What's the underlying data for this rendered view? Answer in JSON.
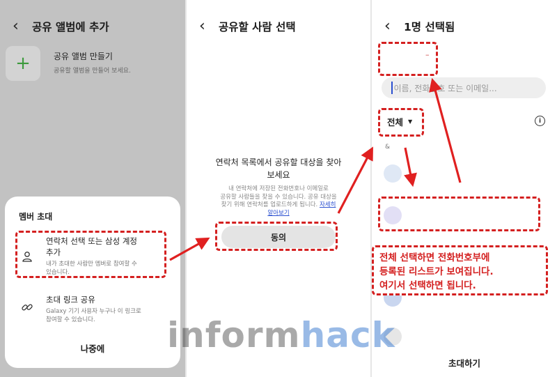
{
  "panel1": {
    "title": "공유 앨범에 추가",
    "create_album": {
      "title": "공유 앨범 만들기",
      "subtitle": "공유할 앨범을 만들어 보세요."
    },
    "invite_sheet": {
      "title": "멤버 초대",
      "option1": {
        "title_line1": "연락처 선택 또는 삼성 계정",
        "title_line2": "추가",
        "sub_line1": "내가 초대한 사람만 멤버로 참여할 수",
        "sub_line2": "있습니다."
      },
      "option2": {
        "title": "초대 링크 공유",
        "sub_line1": "Galaxy 기기 사용자 누구나 이 링크로",
        "sub_line2": "참여할 수 있습니다."
      },
      "later_label": "나중에"
    }
  },
  "panel2": {
    "title": "공유할 사람 선택",
    "prompt_line1": "연락처 목록에서 공유할 대상을 찾아",
    "prompt_line2": "보세요",
    "desc_line1": "내 연락처에 저장된 전화번호나 이메일로",
    "desc_line2": "공유할 사람들을 찾을 수 있습니다. 공유 대상을",
    "desc_line3": "찾기 위해 연락처를 업로드하게 됩니다.",
    "desc_link": "자세히",
    "learn_more": "알아보기",
    "agree_label": "동의"
  },
  "panel3": {
    "title": "1명 선택됨",
    "chip_remove": "–",
    "search_placeholder": "이름, 전화번호 또는 이메일...",
    "filter_label": "전체",
    "index_label": "&",
    "invite_label": "초대하기"
  },
  "annotation": {
    "line1": "전체 선택하면 전화번호부에",
    "line2": "등록된 리스트가 보여집니다.",
    "line3": "여기서 선택하면 됩니다."
  },
  "watermark": {
    "part1": "inform",
    "part2": "hack"
  },
  "colors": {
    "annotation_red": "#d42020",
    "link_blue": "#2a4fd0",
    "plus_green": "#3c9a3c",
    "left_panel_dim": "#c2c2c2"
  },
  "icons": [
    "back-arrow-icon",
    "plus-icon",
    "person-icon",
    "link-icon",
    "info-icon",
    "dropdown-triangle-icon"
  ]
}
